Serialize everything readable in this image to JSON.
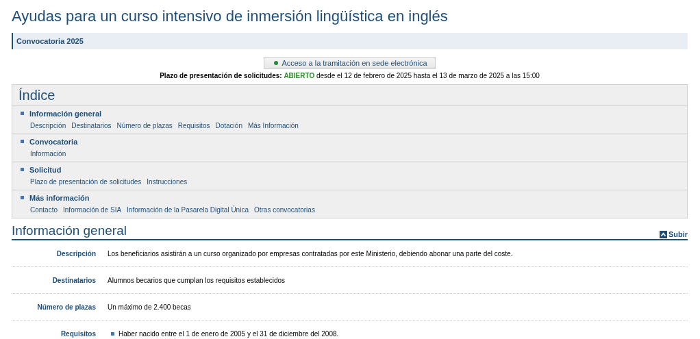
{
  "page_title": "Ayudas para un curso intensivo de inmersión lingüística en inglés",
  "call_bar": "Convocatoria 2025",
  "access_button": "Acceso a la tramitación en sede electrónica",
  "deadline": {
    "label": "Plazo de presentación de solicitudes:",
    "status": "ABIERTO",
    "status_open": true,
    "period": "desde el 12 de febrero de 2025 hasta el 13 de marzo de 2025 a las 15:00"
  },
  "index": {
    "title": "Índice",
    "sections": [
      {
        "title": "Información general",
        "links": [
          "Descripción",
          "Destinatarios",
          "Número de plazas",
          "Requisitos",
          "Dotación",
          "Más Información"
        ]
      },
      {
        "title": "Convocatoria",
        "links": [
          "Información"
        ]
      },
      {
        "title": "Solicitud",
        "links": [
          "Plazo de presentación de solicitudes",
          "Instrucciones"
        ]
      },
      {
        "title": "Más información",
        "links": [
          "Contacto",
          "Información de SIA",
          "Información de la Pasarela Digital Única",
          "Otras convocatorias"
        ]
      }
    ]
  },
  "general_info": {
    "title": "Información general",
    "up_link": "Subir",
    "rows": [
      {
        "label": "Descripción",
        "kind": "text",
        "value": "Los beneficiarios asistirán a un curso organizado por empresas contratadas por este Ministerio, debiendo abonar una parte del coste."
      },
      {
        "label": "Destinatarios",
        "kind": "text",
        "value": "Alumnos becarios que cumplan los requisitos establecidos"
      },
      {
        "label": "Número de plazas",
        "kind": "text",
        "value": "Un máximo de 2.400 becas"
      },
      {
        "label": "Requisitos",
        "kind": "list",
        "items": [
          "Haber nacido entre el 1 de enero de 2005 y el 31 de diciembre del 2008."
        ]
      }
    ]
  }
}
